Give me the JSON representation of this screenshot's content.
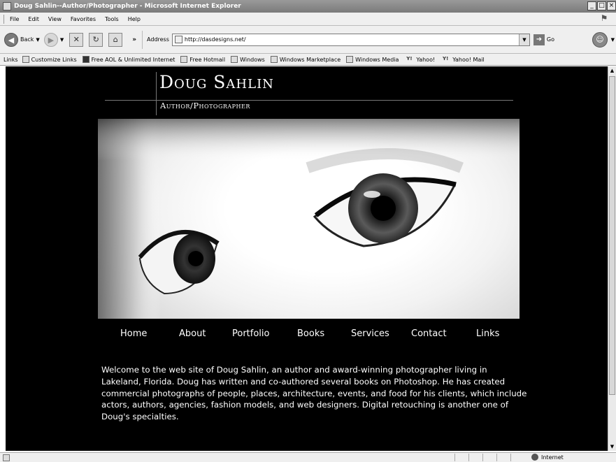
{
  "window": {
    "title": "Doug Sahlin--Author/Photographer - Microsoft Internet Explorer",
    "controls": [
      "_",
      "□",
      "×"
    ]
  },
  "menu": [
    "File",
    "Edit",
    "View",
    "Favorites",
    "Tools",
    "Help"
  ],
  "toolbar": {
    "back_label": "Back",
    "more": "»",
    "address_label": "Address",
    "url": "http://dasdesigns.net/",
    "go_label": "Go"
  },
  "links_bar": {
    "label": "Links",
    "items": [
      {
        "label": "Customize Links",
        "icon": "page-icon"
      },
      {
        "label": "Free AOL & Unlimited Internet",
        "icon": "aol-icon"
      },
      {
        "label": "Free Hotmail",
        "icon": "page-icon"
      },
      {
        "label": "Windows",
        "icon": "page-icon"
      },
      {
        "label": "Windows Marketplace",
        "icon": "windows-icon"
      },
      {
        "label": "Windows Media",
        "icon": "page-icon"
      },
      {
        "label": "Yahoo!",
        "icon": "yahoo-icon"
      },
      {
        "label": "Yahoo! Mail",
        "icon": "yahoo-icon"
      }
    ]
  },
  "site": {
    "name": "Doug Sahlin",
    "tagline": "Author/Photographer",
    "nav": [
      "Home",
      "About",
      "Portfolio",
      "Books",
      "Services",
      "Contact",
      "Links"
    ],
    "intro": "Welcome to the web site of Doug Sahlin, an author and award-winning photographer living in Lakeland, Florida. Doug has written and co-authored several books on Photoshop. He has created commercial photographs of people, places, architecture, events, and food for his clients, which include actors, authors, agencies, fashion models, and web designers. Digital retouching is another one of Doug's specialties."
  },
  "status": {
    "zone": "Internet"
  }
}
